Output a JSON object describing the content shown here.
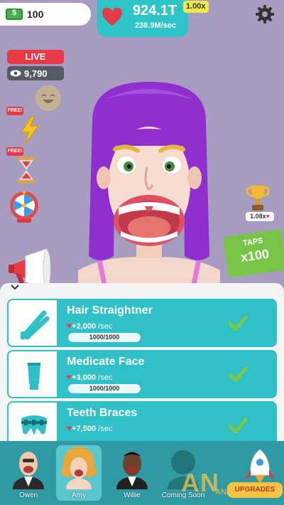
{
  "top_bar": {
    "cash": "100",
    "total_hearts": "924.1T",
    "rate": "238.9M/sec",
    "multiplier": "1.00x"
  },
  "stream": {
    "live_label": "LIVE",
    "viewers": "9,790"
  },
  "boosts": {
    "free_labels": [
      "FREE!",
      "FREE!"
    ]
  },
  "trophy": {
    "multiplier": "1.08x"
  },
  "taps_sign": {
    "label": "TAPS",
    "value": "x100"
  },
  "upgrades": [
    {
      "name": "Hair Straightner",
      "rate_value": "+2,000",
      "rate_unit": "/sec",
      "progress_text": "1000/1000",
      "progress": 1.0,
      "icon": "hair-straightener-icon"
    },
    {
      "name": "Medicate Face",
      "rate_value": "+3,000",
      "rate_unit": "/sec",
      "progress_text": "1000/1000",
      "progress": 1.0,
      "icon": "cream-tube-icon"
    },
    {
      "name": "Teeth Braces",
      "rate_value": "+7,500",
      "rate_unit": "/sec",
      "icon": "braces-icon"
    }
  ],
  "doctors": [
    {
      "name": "Owen",
      "selected": false
    },
    {
      "name": "Amy",
      "selected": true
    },
    {
      "name": "Willie",
      "selected": false
    },
    {
      "name": "Coming Soon",
      "selected": false
    }
  ],
  "upgrades_button": {
    "label": "UPGRADES"
  },
  "watermark": {
    "big": "AN",
    "small": "ANFENSI.COM"
  },
  "colors": {
    "background": "#a59cc0",
    "teal": "#2fc0c8",
    "heart_red": "#e63b47",
    "check_green": "#7ac943"
  }
}
